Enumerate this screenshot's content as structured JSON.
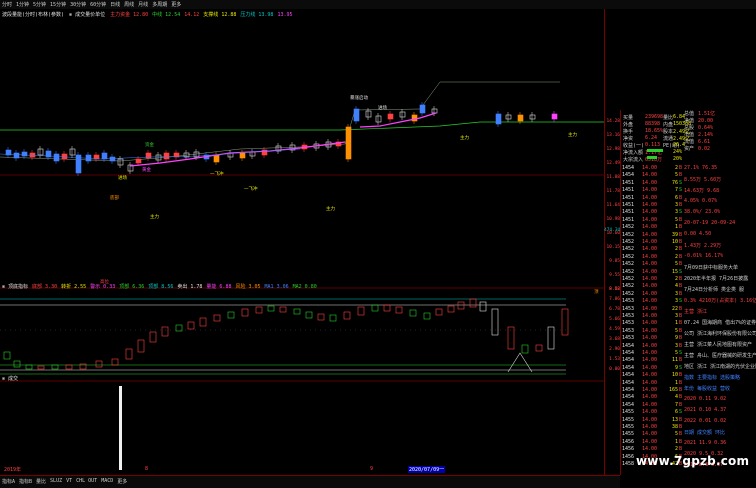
{
  "toolbar": {
    "items": [
      "分时",
      "1分钟",
      "5分钟",
      "15分钟",
      "30分钟",
      "60分钟",
      "日线",
      "周线",
      "月线",
      "多周期",
      "更多"
    ]
  },
  "indicators": {
    "main_title": "波段量能(分时)布林(参数)",
    "main_sub": "⊗ 成交量价单位",
    "main_values": [
      {
        "label": "主力资金 ",
        "value": "12.80",
        "color": "#ff4040"
      },
      {
        "label": "中线 ",
        "value": "12.54",
        "color": "#28d028"
      },
      {
        "label": "",
        "value": "14.12",
        "color": "#ff4040"
      },
      {
        "label": "支撑线 ",
        "value": "12.88",
        "color": "#e8e800"
      },
      {
        "label": "压力线 ",
        "value": "13.98",
        "color": "#00c8c8"
      },
      {
        "label": "",
        "value": "13.95",
        "color": "#ff40ff"
      }
    ],
    "sub1_title": "⊗ 顶底指标",
    "sub1_values": [
      {
        "label": "底部 ",
        "value": "3.30",
        "color": "#ff4040"
      },
      {
        "label": "转折 ",
        "value": "2.55",
        "color": "#e8e800"
      },
      {
        "label": "警示 ",
        "value": "0.33",
        "color": "#ff40ff"
      },
      {
        "label": "顶部 ",
        "value": "6.36",
        "color": "#28d028"
      },
      {
        "label": "顶部 ",
        "value": "8.56",
        "color": "#00c8c8"
      },
      {
        "label": "卖出 ",
        "value": "1.78",
        "color": "#e0e0e0"
      },
      {
        "label": "量能 ",
        "value": "6.88",
        "color": "#ff40ff"
      },
      {
        "label": "风险 ",
        "value": "3.05",
        "color": "#ff9000"
      },
      {
        "label": "MA1 ",
        "value": "3.06",
        "color": "#4080ff"
      },
      {
        "label": "MA2 ",
        "value": "0.80",
        "color": "#28d028"
      }
    ],
    "sub2_title": "⊗ 成交"
  },
  "price_axis": [
    "14.28",
    "13.16",
    "12.98",
    "12.49",
    "11.88",
    "11.78",
    "11.64",
    "10.98",
    "10.60",
    "10.15",
    "9.85",
    "9.55",
    "9.02"
  ],
  "price_axis2": [
    "8.58",
    "7.86",
    "6.78",
    "5.66",
    "4.59",
    "3.68",
    "2.90",
    "1.53",
    "0.00"
  ],
  "chart_annotations": [
    {
      "text": "底部",
      "color": "#ff9000"
    },
    {
      "text": "资金",
      "color": "#28d028"
    },
    {
      "text": "进场",
      "color": "#e8e800"
    },
    {
      "text": "黄金",
      "color": "#ff40ff"
    },
    {
      "text": "一飞冲",
      "color": "#e8e800"
    },
    {
      "text": "一飞冲",
      "color": "#e8e800"
    },
    {
      "text": "主力",
      "color": "#e8e800"
    },
    {
      "text": "主力",
      "color": "#e8e800"
    },
    {
      "text": "暴涨启动",
      "color": "#e0e0e0"
    },
    {
      "text": "进场",
      "color": "#e0e0e0"
    },
    {
      "text": "主力",
      "color": "#e8e800"
    },
    {
      "text": "主力",
      "color": "#e8e800"
    },
    {
      "text": "高位",
      "color": "#ff4040"
    },
    {
      "text": "顶",
      "color": "#ff9000"
    }
  ],
  "quote": {
    "rows": [
      {
        "l": "买量",
        "v": "239698",
        "l2": "量比",
        "v2": "6.84"
      },
      {
        "l": "外盘",
        "v": "88398",
        "l2": "内盘",
        "v2": "150308"
      },
      {
        "l": "换手",
        "v": "18.65%",
        "l2": "股本",
        "v2": "2.49亿"
      },
      {
        "l": "净资",
        "v": "6.24",
        "l2": "流通",
        "v2": "2.49亿"
      },
      {
        "l": "收益(一)",
        "v": "0.113",
        "l2": "PE(动)",
        "v2": "26.4"
      },
      {
        "l": "净流入额",
        "v": "1.17亿",
        "l2": "",
        "v2": "24%"
      },
      {
        "l": "大宗流入",
        "v": "6518万",
        "l2": "",
        "v2": "20%"
      }
    ]
  },
  "ticks": [
    {
      "t": "1454",
      "p": "14.00",
      "v": "2",
      "d": "B"
    },
    {
      "t": "1454",
      "p": "14.00",
      "v": "5",
      "d": "B"
    },
    {
      "t": "1451",
      "p": "14.00",
      "v": "76",
      "d": "S"
    },
    {
      "t": "1451",
      "p": "14.00",
      "v": "7",
      "d": "S"
    },
    {
      "t": "1451",
      "p": "14.00",
      "v": "6",
      "d": "B"
    },
    {
      "t": "1451",
      "p": "14.00",
      "v": "3",
      "d": "B"
    },
    {
      "t": "1451",
      "p": "14.00",
      "v": "3",
      "d": "S"
    },
    {
      "t": "1451",
      "p": "14.00",
      "v": "5",
      "d": "B"
    },
    {
      "t": "1452",
      "p": "14.00",
      "v": "1",
      "d": "B"
    },
    {
      "t": "1452",
      "p": "14.00",
      "v": "39",
      "d": "B"
    },
    {
      "t": "1452",
      "p": "14.00",
      "v": "10",
      "d": "B"
    },
    {
      "t": "1452",
      "p": "14.00",
      "v": "2",
      "d": "B"
    },
    {
      "t": "1452",
      "p": "14.00",
      "v": "2",
      "d": "B"
    },
    {
      "t": "1452",
      "p": "14.00",
      "v": "5",
      "d": "B"
    },
    {
      "t": "1452",
      "p": "14.00",
      "v": "15",
      "d": "S"
    },
    {
      "t": "1452",
      "p": "14.00",
      "v": "2",
      "d": "B"
    },
    {
      "t": "1452",
      "p": "14.00",
      "v": "4",
      "d": "B"
    },
    {
      "t": "1452",
      "p": "14.00",
      "v": "3",
      "d": "B"
    },
    {
      "t": "1453",
      "p": "14.00",
      "v": "3",
      "d": "S"
    },
    {
      "t": "1453",
      "p": "14.00",
      "v": "22",
      "d": "B"
    },
    {
      "t": "1453",
      "p": "14.00",
      "v": "3",
      "d": "B"
    },
    {
      "t": "1453",
      "p": "14.00",
      "v": "1",
      "d": "B"
    },
    {
      "t": "1453",
      "p": "14.00",
      "v": "5",
      "d": "B"
    },
    {
      "t": "1453",
      "p": "14.00",
      "v": "9",
      "d": "B"
    },
    {
      "t": "1454",
      "p": "14.00",
      "v": "3",
      "d": "B"
    },
    {
      "t": "1454",
      "p": "14.00",
      "v": "5",
      "d": "S"
    },
    {
      "t": "1454",
      "p": "14.00",
      "v": "11",
      "d": "B"
    },
    {
      "t": "1454",
      "p": "14.00",
      "v": "9",
      "d": "S"
    },
    {
      "t": "1454",
      "p": "14.00",
      "v": "10",
      "d": "B"
    },
    {
      "t": "1454",
      "p": "14.00",
      "v": "1",
      "d": "B"
    },
    {
      "t": "1454",
      "p": "14.00",
      "v": "165",
      "d": "B"
    },
    {
      "t": "1454",
      "p": "14.00",
      "v": "4",
      "d": "B"
    },
    {
      "t": "1454",
      "p": "14.00",
      "v": "7",
      "d": "B"
    },
    {
      "t": "1455",
      "p": "14.00",
      "v": "6",
      "d": "S"
    },
    {
      "t": "1455",
      "p": "14.00",
      "v": "13",
      "d": "B"
    },
    {
      "t": "1455",
      "p": "14.00",
      "v": "38",
      "d": "B"
    },
    {
      "t": "1455",
      "p": "14.00",
      "v": "5",
      "d": "B"
    },
    {
      "t": "1456",
      "p": "14.00",
      "v": "1",
      "d": "B"
    },
    {
      "t": "1456",
      "p": "14.00",
      "v": "2",
      "d": "B"
    },
    {
      "t": "1456",
      "p": "14.00",
      "v": "6",
      "d": "B"
    },
    {
      "t": "1458",
      "p": "14.00",
      "v": "42",
      "d": "B"
    }
  ],
  "f10": {
    "head": [
      {
        "l": "总值",
        "v": "1.51亿"
      },
      {
        "l": "净值",
        "v": "20.00"
      },
      {
        "l": "总股",
        "v": "0.64%"
      },
      {
        "l": "市值",
        "v": "2.14%"
      },
      {
        "l": "流值",
        "v": "6.61"
      },
      {
        "l": "资产",
        "v": "0.02"
      }
    ],
    "lines": [
      "27.1% 76.35",
      "8.55万 5.60万",
      "14.63万 9.68",
      "4.05% 0.07%",
      "38.0%/ 23.0%",
      "20-07-19 20-09-24",
      "0.00 4.50",
      "1.43万 2.29万",
      "-0.01% 16.17%",
      "7月09日获中标服务大单",
      "2020年半年报 7月26日披露",
      "7月24日分析师 类企类 服",
      "0.3% 4210万(占资本) 3.16亿",
      "主营 浙江",
      "07.24 国海期商 借出7%的证券",
      "公司 浙江海利环保股份有限公司",
      "主营 浙江菜人民地图有限资产",
      "主营 舟山、医疗器械的研发生产",
      "地区 浙江 浙江南湖的光伏企业区域",
      "指数 主要指标 选股策略",
      "年份 每股收益 营收",
      "2020 0.11 9.02",
      "2021 0.10 4.37",
      "2022 0.01 0.02",
      "日期 成交额 环比",
      "2021 11.9 0.36",
      "2020 9.5 0.32",
      "2019 8.3 0.27"
    ]
  },
  "right_axis_marker": "474.34",
  "bottom_bar": {
    "left_date": "2019年",
    "mid_marks": [
      "8",
      "9"
    ],
    "highlight_date": "2020/07/09一",
    "tabs": [
      "指标A",
      "指标B",
      "量比",
      "SLUZ",
      "VT",
      "CHL OUT",
      "MACD",
      "更多"
    ]
  },
  "watermark": "www.7gpzb.com"
}
